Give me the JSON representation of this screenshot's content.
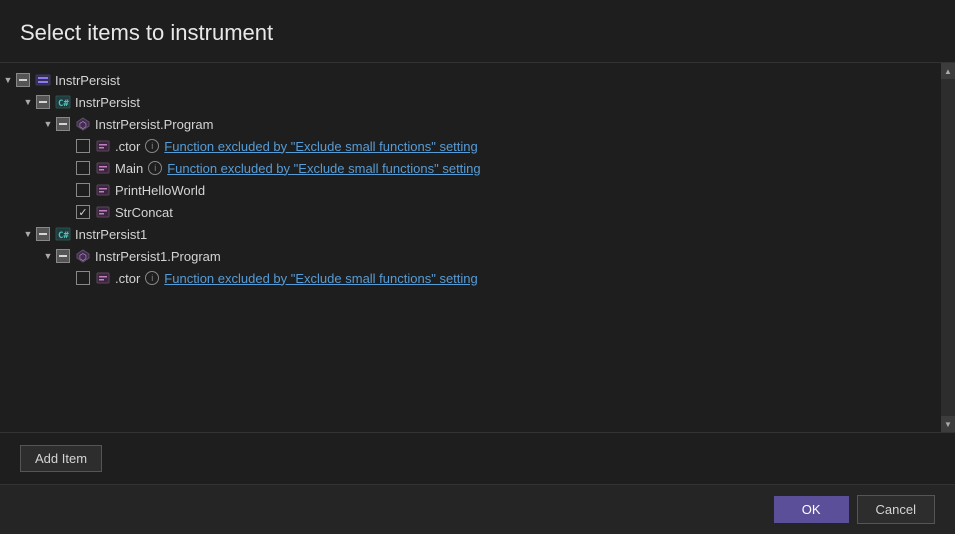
{
  "title": "Select items to instrument",
  "tree": {
    "items": [
      {
        "id": "instrpersist-assembly",
        "indent": 0,
        "expander": "expanded",
        "checkbox": "indeterminate",
        "icon": "assembly",
        "label": "InstrPersist",
        "info": false,
        "link": null
      },
      {
        "id": "instrpersist-namespace",
        "indent": 1,
        "expander": "expanded",
        "checkbox": "indeterminate",
        "icon": "namespace",
        "label": "InstrPersist",
        "info": false,
        "link": null
      },
      {
        "id": "instrpersist-program-class",
        "indent": 2,
        "expander": "expanded",
        "checkbox": "indeterminate",
        "icon": "class",
        "label": "InstrPersist.Program",
        "info": false,
        "link": null
      },
      {
        "id": "ctor1",
        "indent": 3,
        "expander": "leaf",
        "checkbox": "unchecked",
        "icon": "method",
        "label": ".ctor",
        "info": true,
        "link": "Function excluded by \"Exclude small functions\" setting"
      },
      {
        "id": "main",
        "indent": 3,
        "expander": "leaf",
        "checkbox": "unchecked",
        "icon": "method",
        "label": "Main",
        "info": true,
        "link": "Function excluded by \"Exclude small functions\" setting"
      },
      {
        "id": "printhelloworld",
        "indent": 3,
        "expander": "leaf",
        "checkbox": "unchecked",
        "icon": "method",
        "label": "PrintHelloWorld",
        "info": false,
        "link": null
      },
      {
        "id": "strconcat",
        "indent": 3,
        "expander": "leaf",
        "checkbox": "checked",
        "icon": "method",
        "label": "StrConcat",
        "info": false,
        "link": null
      },
      {
        "id": "instrpersist1-assembly",
        "indent": 1,
        "expander": "expanded",
        "checkbox": "indeterminate",
        "icon": "namespace",
        "label": "InstrPersist1",
        "info": false,
        "link": null
      },
      {
        "id": "instrpersist1-program-class",
        "indent": 2,
        "expander": "expanded",
        "checkbox": "indeterminate",
        "icon": "class",
        "label": "InstrPersist1.Program",
        "info": false,
        "link": null
      },
      {
        "id": "ctor2",
        "indent": 3,
        "expander": "leaf",
        "checkbox": "unchecked",
        "icon": "method",
        "label": ".ctor",
        "info": true,
        "link": "Function excluded by \"Exclude small functions\" setting"
      }
    ]
  },
  "buttons": {
    "add_item": "Add Item",
    "ok": "OK",
    "cancel": "Cancel"
  }
}
